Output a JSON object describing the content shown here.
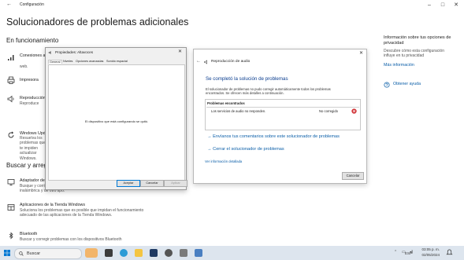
{
  "settings": {
    "app_title": "Configuración",
    "page_title": "Solucionadores de problemas adicionales",
    "section_running": "En funcionamiento",
    "section_find": "Buscar y arregl",
    "items_running": [
      {
        "title": "Conexiones a",
        "desc": "web."
      },
      {
        "title": "Impresora",
        "desc": ""
      },
      {
        "title": "Reproducción",
        "desc": "Reproduce"
      },
      {
        "title": "Windows Upd",
        "desc": "Resuelva los problemas que te impiden actualizar Windows."
      }
    ],
    "items_find": [
      {
        "title": "Adaptador de",
        "desc": "Busque y corrija problemas con adaptadores de red inalámbrica y de otro tipo."
      },
      {
        "title": "Aplicaciones de la Tienda Windows",
        "desc": "Soluciona los problemas que es posible que impidan el funcionamiento adecuado de las aplicaciones de la Tienda Windows."
      },
      {
        "title": "Bluetooth",
        "desc": "Buscar y corregir problemas con los dispositivos Bluetooth"
      }
    ],
    "right": {
      "title": "Información sobre tus opciones de privacidad",
      "desc": "Descubre cómo esta configuración influye en tu privacidad",
      "link": "Más información",
      "help": "Obtener ayuda"
    }
  },
  "props_dialog": {
    "title": "Propiedades: Altavoces",
    "tabs": [
      "General",
      "Niveles",
      "Opciones avanzadas",
      "Sonido espacial"
    ],
    "message": "El dispositivo que está configurando se quitó.",
    "buttons": {
      "ok": "Aceptar",
      "cancel": "Cancelar",
      "apply": "Aplicar"
    }
  },
  "troubleshooter": {
    "title": "Reproducción de audio",
    "heading": "Se completó la solución de problemas",
    "body": "El solucionador de problemas no pudo corregir automáticamente todos los problemas encontrados. Se ofrecen más detalles a continuación.",
    "problems_header": "Problemas encontrados",
    "problem": "Los servicios de audio no responden.",
    "status": "No corregido",
    "link_feedback": "Envíanos tus comentarios sobre este solucionador de problemas",
    "link_close": "Cerrar el solucionador de problemas",
    "details": "Ver información detallada",
    "cancel": "Cancelar"
  },
  "taskbar": {
    "search": "Buscar",
    "lang": "ESP",
    "time": "03:05 p. m.",
    "date": "02/05/2024"
  },
  "colors": {
    "accent": "#0a5ea8",
    "error": "#d13438",
    "taskbar": "#dde5ee"
  }
}
